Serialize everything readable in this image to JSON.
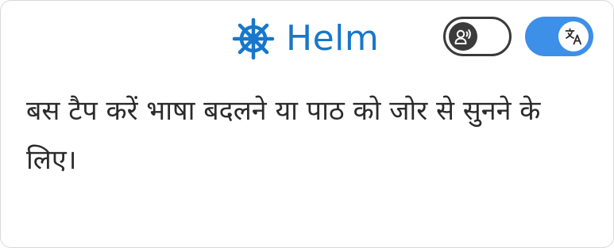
{
  "header": {
    "brand_name": "Helm",
    "brand_icon": "ship-wheel-icon"
  },
  "toggles": {
    "speak": {
      "icon": "speaking-head-icon",
      "state": "off"
    },
    "translate": {
      "icon": "translate-icon",
      "state": "on"
    }
  },
  "message": {
    "text": "बस टैप करें भाषा बदलने या पाठ को जोर से सुनने के लिए।"
  },
  "colors": {
    "brand": "#1877c9",
    "toggle_on": "#3d8fe8",
    "toggle_off_border": "#3a3a3a",
    "text": "#2b2b2b"
  }
}
